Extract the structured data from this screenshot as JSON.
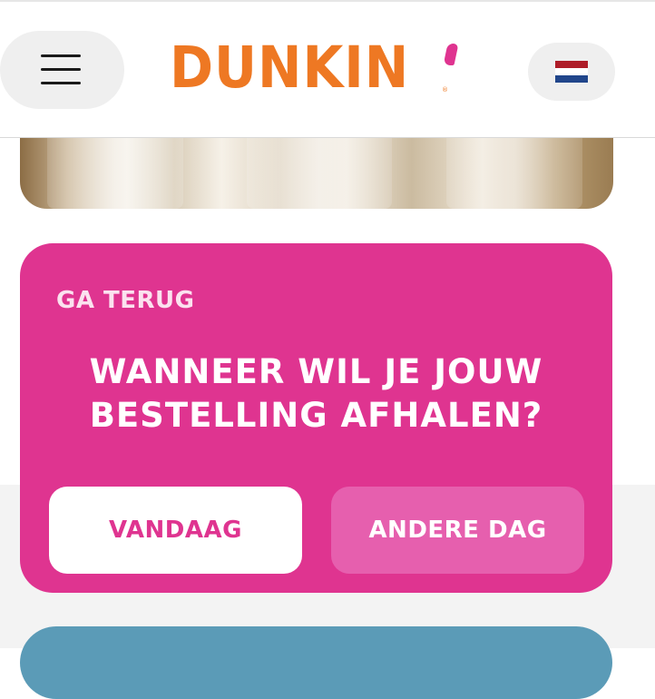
{
  "header": {
    "brand": "DUNKIN",
    "registered_mark": "®",
    "menu_icon": "hamburger-icon",
    "language_flag": "nl-flag-icon",
    "flag_colors": [
      "#ae1c28",
      "#ffffff",
      "#21468b"
    ]
  },
  "pickup_card": {
    "back_label": "GA TERUG",
    "question_line1": "WANNEER WIL JE JOUW",
    "question_line2": "BESTELLING AFHALEN?",
    "today_label": "VANDAAG",
    "other_day_label": "ANDERE DAG"
  },
  "colors": {
    "brand_orange": "#ee7823",
    "brand_pink": "#df3490",
    "other_day_pink": "#e65fae",
    "next_card_blue": "#5b9bb7"
  }
}
